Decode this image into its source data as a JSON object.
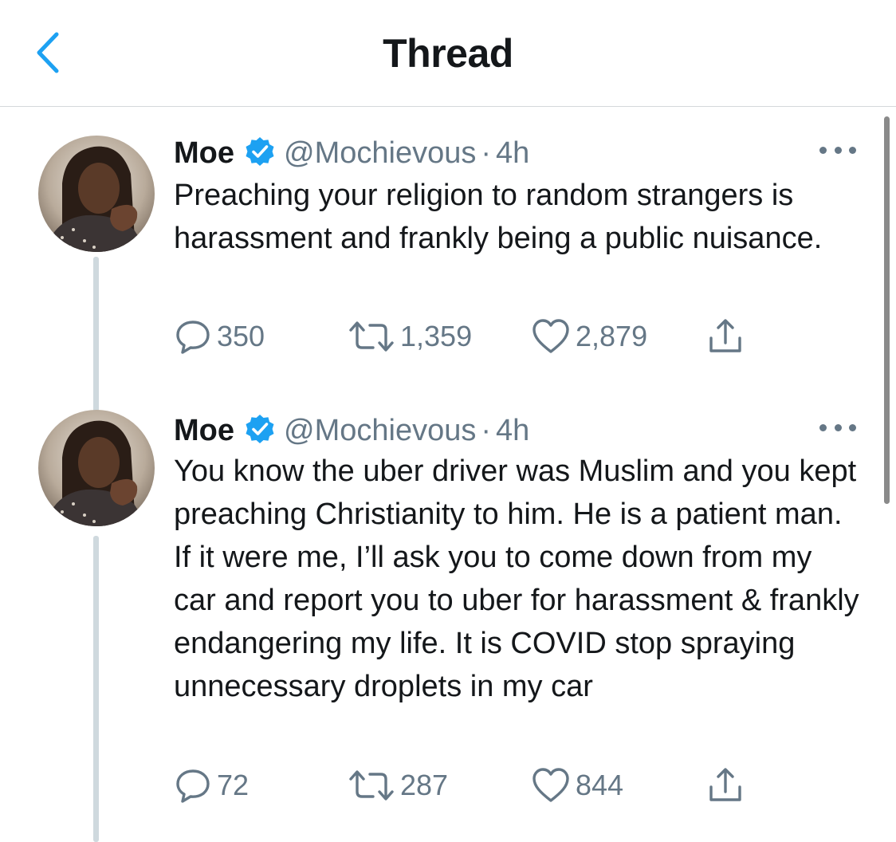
{
  "header": {
    "title": "Thread",
    "back_icon": "chevron-left-icon",
    "accent": "#1da1f2"
  },
  "tweets": [
    {
      "name": "Moe",
      "handle": "@Mochievous",
      "separator": "·",
      "time": "4h",
      "verified": true,
      "text": "Preaching your religion to random strangers is harassment and frankly being a public nuisance.",
      "replies": "350",
      "retweets": "1,359",
      "likes": "2,879"
    },
    {
      "name": "Moe",
      "handle": "@Mochievous",
      "separator": "·",
      "time": "4h",
      "verified": true,
      "text": "You know the uber driver was Muslim and you kept preaching Christianity to him. He is a patient man. If it were me, I’ll ask you to come down from my car and report you to uber for harassment & frankly endangering my life. It is COVID stop spraying unnecessary droplets in my car",
      "replies": "72",
      "retweets": "287",
      "likes": "844"
    }
  ],
  "colors": {
    "text_primary": "#14171a",
    "text_secondary": "#657786",
    "verified_badge": "#1da1f2",
    "divider": "#d4d8db",
    "thread_line": "#cfd9de"
  }
}
